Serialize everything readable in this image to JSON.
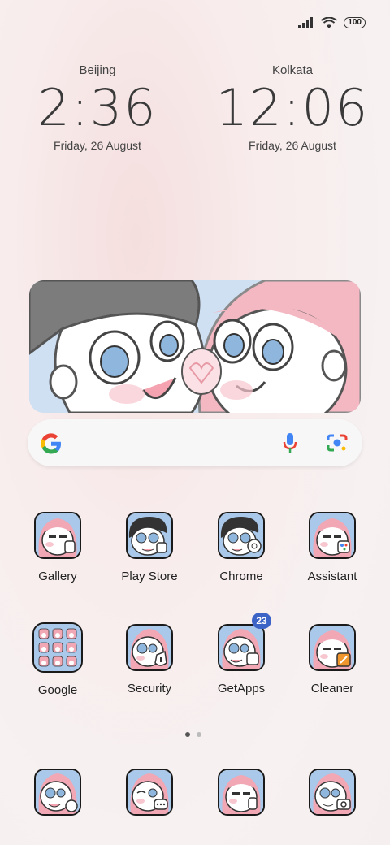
{
  "status_bar": {
    "battery": "100",
    "signal_icon": "signal-icon",
    "wifi_icon": "wifi-icon"
  },
  "clocks": [
    {
      "city": "Beijing",
      "time": "2:36",
      "date": "Friday, 26 August"
    },
    {
      "city": "Kolkata",
      "time": "12:06",
      "date": "Friday, 26 August"
    }
  ],
  "search": {
    "google_icon": "google-g-icon",
    "mic_icon": "mic-icon",
    "lens_icon": "lens-icon"
  },
  "apps_row1": [
    {
      "label": "Gallery"
    },
    {
      "label": "Play Store"
    },
    {
      "label": "Chrome"
    },
    {
      "label": "Assistant"
    }
  ],
  "apps_row2": [
    {
      "label": "Google"
    },
    {
      "label": "Security"
    },
    {
      "label": "GetApps",
      "badge": "23"
    },
    {
      "label": "Cleaner"
    }
  ],
  "page_indicator": {
    "pages": 2,
    "current": 1
  },
  "colors": {
    "badge": "#3c63c6",
    "icon_pink_hair": "#f2a7b5",
    "icon_bg": "#a9c8ea"
  }
}
